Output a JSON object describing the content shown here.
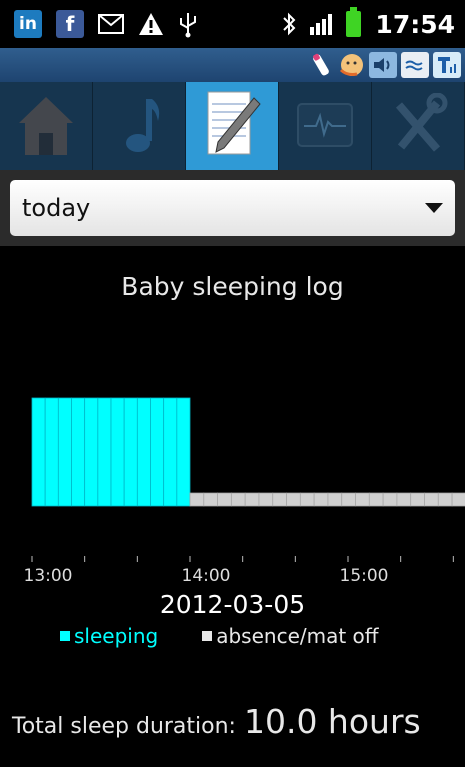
{
  "status_bar": {
    "time": "17:54",
    "left_icons": [
      "linkedin-icon",
      "facebook-icon",
      "mail-icon",
      "warning-icon",
      "usb-icon"
    ],
    "right_icons": [
      "bluetooth-icon",
      "signal-icon",
      "battery-charging-icon"
    ],
    "linkedin_glyph": "in",
    "facebook_glyph": "f"
  },
  "tabs": [
    {
      "name": "home",
      "icon": "house-icon"
    },
    {
      "name": "music",
      "icon": "music-note-icon"
    },
    {
      "name": "log",
      "icon": "notepad-pen-icon",
      "active": true
    },
    {
      "name": "monitor",
      "icon": "heart-monitor-icon"
    },
    {
      "name": "settings",
      "icon": "tools-icon"
    }
  ],
  "period_select": {
    "value": "today"
  },
  "chart": {
    "title": "Baby sleeping log",
    "date": "2012-03-05",
    "legend_sleeping": "sleeping",
    "legend_absence": "absence/mat off",
    "colors": {
      "sleeping": "#00ffff",
      "absence": "#d0d0d0"
    }
  },
  "chart_data": {
    "type": "bar",
    "title": "Baby sleeping log",
    "xlabel": "2012-03-05",
    "ylabel": "",
    "x_ticks": [
      "13:00",
      "14:00",
      "15:00"
    ],
    "series": [
      {
        "name": "sleeping",
        "start": "13:00",
        "end": "14:00",
        "level": 1.0,
        "segments": 12
      },
      {
        "name": "absence/mat off",
        "start": "14:00",
        "end": "15:50",
        "level": 0.12,
        "segments": 21
      }
    ],
    "legend_position": "bottom"
  },
  "summary": {
    "label": "Total sleep duration:",
    "value": "10.0 hours"
  }
}
